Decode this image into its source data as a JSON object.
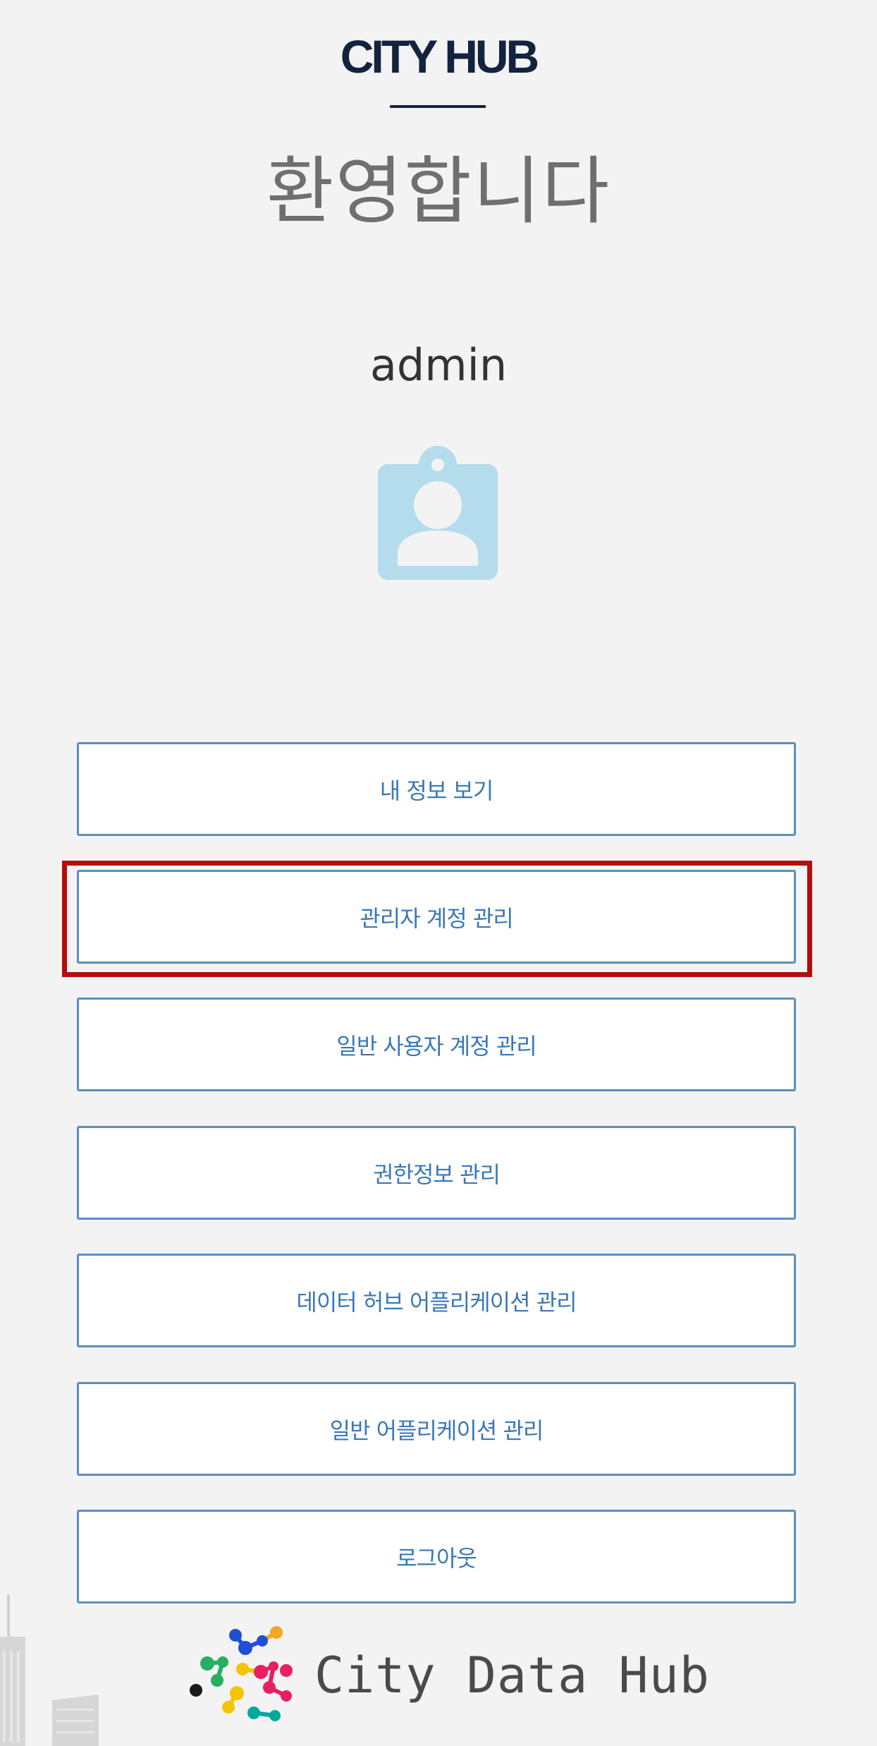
{
  "header": {
    "app_title": "CITY HUB",
    "welcome": "환영합니다",
    "username": "admin"
  },
  "icons": {
    "profile": "profile-badge-icon",
    "logo": "city-data-hub-logo",
    "skyline": "city-skyline-decoration"
  },
  "menu": {
    "items": [
      {
        "label": "내 정보 보기"
      },
      {
        "label": "관리자 계정 관리",
        "highlighted": true
      },
      {
        "label": "일반 사용자 계정 관리"
      },
      {
        "label": "권한정보 관리"
      },
      {
        "label": "데이터 허브 어플리케이션 관리"
      },
      {
        "label": "일반 어플리케이션 관리"
      },
      {
        "label": "로그아웃"
      }
    ]
  },
  "footer": {
    "brand": "City Data Hub"
  },
  "colors": {
    "background": "#f3f3f3",
    "title": "#13233f",
    "button_border": "#5b8ec3",
    "button_text": "#3a78b8",
    "highlight": "#b40d0d",
    "profile_icon": "#b5dcec"
  }
}
